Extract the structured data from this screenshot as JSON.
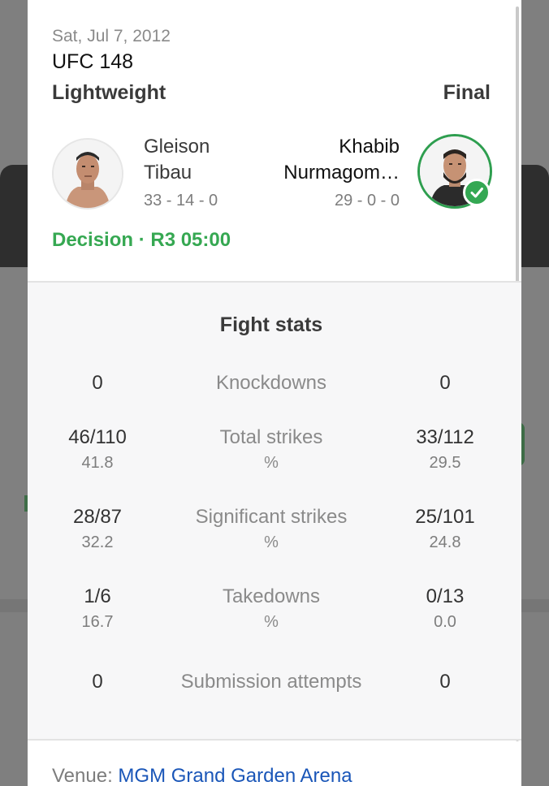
{
  "fight": {
    "date": "Sat, Jul 7, 2012",
    "event": "UFC 148",
    "weight_class": "Lightweight",
    "status": "Final",
    "result": "Decision · R3 05:00"
  },
  "fighters": {
    "left": {
      "name_line1": "Gleison",
      "name_line2": "Tibau",
      "record": "33 - 14 - 0"
    },
    "right": {
      "name_line1": "Khabib",
      "name_line2": "Nurmagom…",
      "record": "29 - 0 - 0",
      "winner": true
    }
  },
  "stats": {
    "title": "Fight stats",
    "rows": [
      {
        "label": "Knockdowns",
        "left": "0",
        "right": "0"
      },
      {
        "label": "Total strikes",
        "pct_label": "%",
        "left": "46/110",
        "left_pct": "41.8",
        "right": "33/112",
        "right_pct": "29.5"
      },
      {
        "label": "Significant strikes",
        "pct_label": "%",
        "left": "28/87",
        "left_pct": "32.2",
        "right": "25/101",
        "right_pct": "24.8"
      },
      {
        "label": "Takedowns",
        "pct_label": "%",
        "left": "1/6",
        "left_pct": "16.7",
        "right": "0/13",
        "right_pct": "0.0"
      },
      {
        "label": "Submission attempts",
        "left": "0",
        "right": "0"
      }
    ]
  },
  "venue": {
    "label": "Venue: ",
    "name": "MGM Grand Garden Arena"
  },
  "colors": {
    "accent_green": "#36a852",
    "link_blue": "#1a56b8"
  }
}
